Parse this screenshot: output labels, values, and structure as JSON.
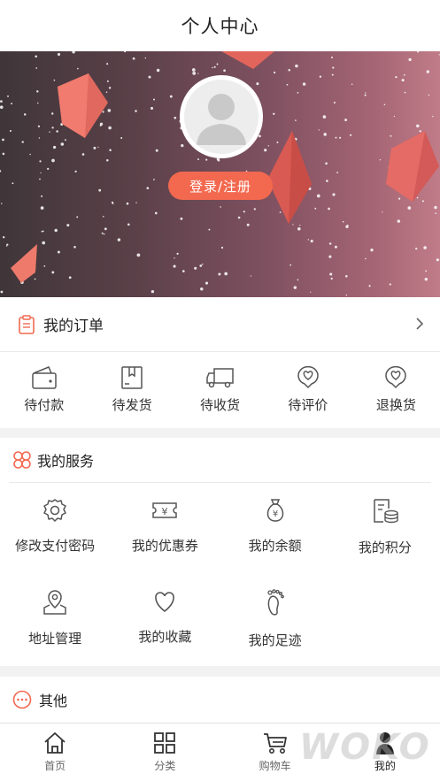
{
  "header": {
    "title": "个人中心"
  },
  "profile": {
    "login_label": "登录/注册"
  },
  "orders": {
    "title": "我的订单",
    "items": [
      {
        "label": "待付款",
        "icon": "wallet-icon"
      },
      {
        "label": "待发货",
        "icon": "package-icon"
      },
      {
        "label": "待收货",
        "icon": "truck-icon"
      },
      {
        "label": "待评价",
        "icon": "heart-bubble-icon"
      },
      {
        "label": "退换货",
        "icon": "heart-bubble-icon"
      }
    ]
  },
  "services": {
    "title": "我的服务",
    "items": [
      {
        "label": "修改支付密码",
        "icon": "gear-icon"
      },
      {
        "label": "我的优惠券",
        "icon": "ticket-icon"
      },
      {
        "label": "我的余额",
        "icon": "money-bag-icon"
      },
      {
        "label": "我的积分",
        "icon": "coins-receipt-icon"
      },
      {
        "label": "地址管理",
        "icon": "map-pin-icon"
      },
      {
        "label": "我的收藏",
        "icon": "heart-icon"
      },
      {
        "label": "我的足迹",
        "icon": "footprint-icon"
      }
    ]
  },
  "other": {
    "title": "其他"
  },
  "tabbar": {
    "items": [
      {
        "label": "首页",
        "icon": "home-icon"
      },
      {
        "label": "分类",
        "icon": "grid-icon"
      },
      {
        "label": "购物车",
        "icon": "cart-icon"
      },
      {
        "label": "我的",
        "icon": "user-icon"
      }
    ],
    "active": "我的"
  },
  "colors": {
    "accent": "#f2694f",
    "text": "#333333",
    "background": "#f2f2f2"
  },
  "watermark": "WOKO"
}
